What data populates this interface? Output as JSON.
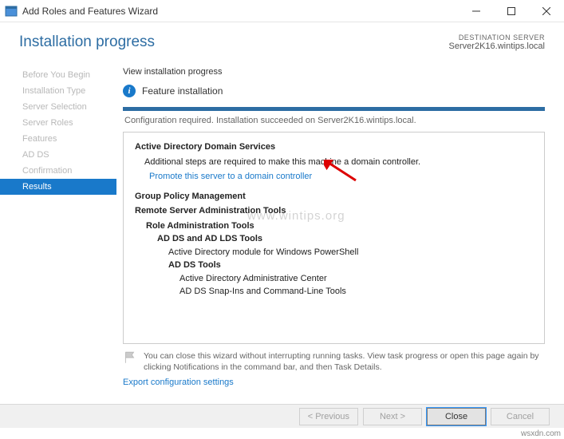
{
  "titlebar": {
    "text": "Add Roles and Features Wizard"
  },
  "header": {
    "title": "Installation progress",
    "dest_label": "DESTINATION SERVER",
    "dest_server": "Server2K16.wintips.local"
  },
  "sidebar": {
    "items": [
      {
        "label": "Before You Begin"
      },
      {
        "label": "Installation Type"
      },
      {
        "label": "Server Selection"
      },
      {
        "label": "Server Roles"
      },
      {
        "label": "Features"
      },
      {
        "label": "AD DS"
      },
      {
        "label": "Confirmation"
      },
      {
        "label": "Results"
      }
    ]
  },
  "main": {
    "view_label": "View installation progress",
    "status": "Feature installation",
    "config_msg": "Configuration required. Installation succeeded on Server2K16.wintips.local.",
    "results": {
      "adds_title": "Active Directory Domain Services",
      "adds_sub": "Additional steps are required to make this machine a domain controller.",
      "promote_link": "Promote this server to a domain controller",
      "gpm": "Group Policy Management",
      "rsat": "Remote Server Administration Tools",
      "rat": "Role Administration Tools",
      "lds": "AD DS and AD LDS Tools",
      "admod": "Active Directory module for Windows PowerShell",
      "adds_tools": "AD DS Tools",
      "adac": "Active Directory Administrative Center",
      "snapins": "AD DS Snap-Ins and Command-Line Tools"
    },
    "hint": "You can close this wizard without interrupting running tasks. View task progress or open this page again by clicking Notifications in the command bar, and then Task Details.",
    "export_link": "Export configuration settings"
  },
  "footer": {
    "previous": "< Previous",
    "next": "Next >",
    "close": "Close",
    "cancel": "Cancel"
  },
  "watermark": "www.wintips.org",
  "credit": "wsxdn.com"
}
